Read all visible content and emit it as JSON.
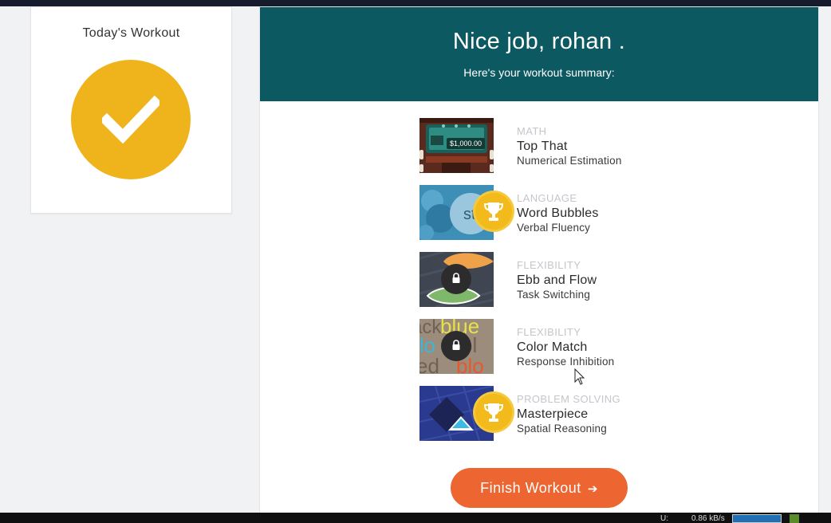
{
  "side": {
    "title": "Today's Workout"
  },
  "header": {
    "title": "Nice job, rohan .",
    "subtitle": "Here's your workout summary:"
  },
  "games": [
    {
      "category": "MATH",
      "name": "Top That",
      "skill": "Numerical Estimation",
      "badge": "none",
      "thumb_text": "$1,000.00"
    },
    {
      "category": "LANGUAGE",
      "name": "Word Bubbles",
      "skill": "Verbal Fluency",
      "badge": "trophy-icon",
      "thumb_text": "st"
    },
    {
      "category": "FLEXIBILITY",
      "name": "Ebb and Flow",
      "skill": "Task Switching",
      "badge": "lock-icon"
    },
    {
      "category": "FLEXIBILITY",
      "name": "Color Match",
      "skill": "Response Inhibition",
      "badge": "lock-icon",
      "thumb_text": "blue"
    },
    {
      "category": "PROBLEM SOLVING",
      "name": "Masterpiece",
      "skill": "Spatial Reasoning",
      "badge": "trophy-icon"
    }
  ],
  "finish": {
    "label": "Finish Workout",
    "arrow": "➔"
  },
  "taskbar": {
    "u_label": "U:",
    "speed": "0.86 kB/s"
  },
  "colors": {
    "header": "#0d5962",
    "check": "#efb31c",
    "trophy": "#f2ba1a",
    "finish": "#ed6631"
  }
}
